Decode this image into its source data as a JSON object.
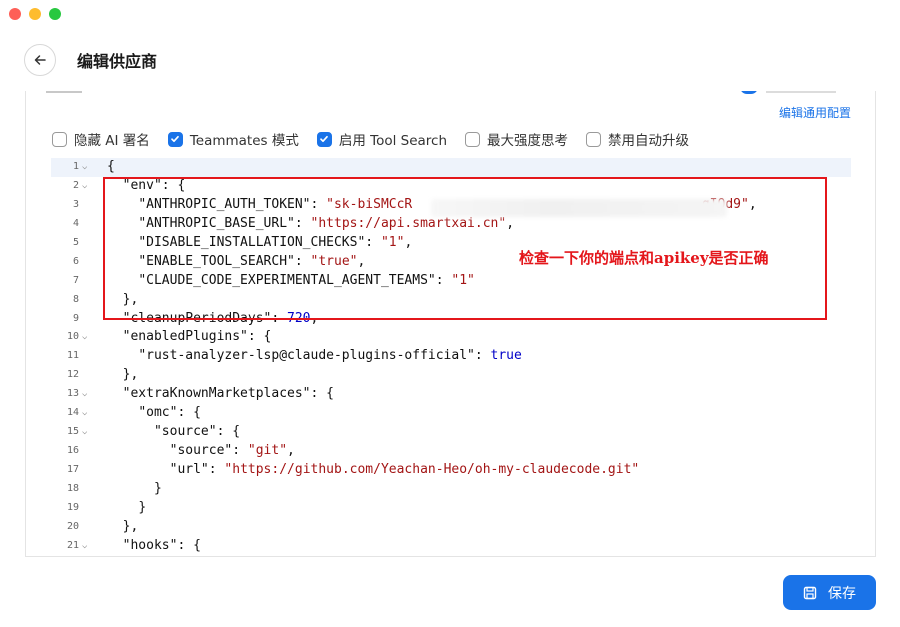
{
  "window": {
    "controls": [
      "close",
      "minimize",
      "maximize"
    ]
  },
  "header": {
    "title": "编辑供应商",
    "back_icon": "arrow-left-icon"
  },
  "panel": {
    "edit_common_label": "编辑通用配置"
  },
  "options": [
    {
      "label": "隐藏 AI 署名",
      "checked": false
    },
    {
      "label": "Teammates 模式",
      "checked": true
    },
    {
      "label": "启用 Tool Search",
      "checked": true
    },
    {
      "label": "最大强度思考",
      "checked": false
    },
    {
      "label": "禁用自动升级",
      "checked": false
    }
  ],
  "editor": {
    "lines": [
      {
        "n": "1",
        "fold": true,
        "indent": 0,
        "parts": [
          [
            "p",
            "{"
          ]
        ]
      },
      {
        "n": "2",
        "fold": true,
        "indent": 1,
        "parts": [
          [
            "k",
            "\"env\""
          ],
          [
            "p",
            ": {"
          ]
        ]
      },
      {
        "n": "3",
        "fold": false,
        "indent": 2,
        "parts": [
          [
            "k",
            "\"ANTHROPIC_AUTH_TOKEN\""
          ],
          [
            "p",
            ": "
          ],
          [
            "s",
            "\"sk-biSMCcR"
          ],
          [
            "p",
            "                                     "
          ],
          [
            "s",
            "gIOd9\""
          ],
          [
            "p",
            ","
          ]
        ]
      },
      {
        "n": "4",
        "fold": false,
        "indent": 2,
        "parts": [
          [
            "k",
            "\"ANTHROPIC_BASE_URL\""
          ],
          [
            "p",
            ": "
          ],
          [
            "s",
            "\"https://api.smartxai.cn\""
          ],
          [
            "p",
            ","
          ]
        ]
      },
      {
        "n": "5",
        "fold": false,
        "indent": 2,
        "parts": [
          [
            "k",
            "\"DISABLE_INSTALLATION_CHECKS\""
          ],
          [
            "p",
            ": "
          ],
          [
            "s",
            "\"1\""
          ],
          [
            "p",
            ","
          ]
        ]
      },
      {
        "n": "6",
        "fold": false,
        "indent": 2,
        "parts": [
          [
            "k",
            "\"ENABLE_TOOL_SEARCH\""
          ],
          [
            "p",
            ": "
          ],
          [
            "s",
            "\"true\""
          ],
          [
            "p",
            ","
          ]
        ]
      },
      {
        "n": "7",
        "fold": false,
        "indent": 2,
        "parts": [
          [
            "k",
            "\"CLAUDE_CODE_EXPERIMENTAL_AGENT_TEAMS\""
          ],
          [
            "p",
            ": "
          ],
          [
            "s",
            "\"1\""
          ]
        ]
      },
      {
        "n": "8",
        "fold": false,
        "indent": 1,
        "parts": [
          [
            "p",
            "},"
          ]
        ]
      },
      {
        "n": "9",
        "fold": false,
        "indent": 1,
        "parts": [
          [
            "k",
            "\"cleanupPeriodDays\""
          ],
          [
            "p",
            ": "
          ],
          [
            "b",
            "720"
          ],
          [
            "p",
            ","
          ]
        ]
      },
      {
        "n": "10",
        "fold": true,
        "indent": 1,
        "parts": [
          [
            "k",
            "\"enabledPlugins\""
          ],
          [
            "p",
            ": {"
          ]
        ]
      },
      {
        "n": "11",
        "fold": false,
        "indent": 2,
        "parts": [
          [
            "k",
            "\"rust-analyzer-lsp@claude-plugins-official\""
          ],
          [
            "p",
            ": "
          ],
          [
            "b",
            "true"
          ]
        ]
      },
      {
        "n": "12",
        "fold": false,
        "indent": 1,
        "parts": [
          [
            "p",
            "},"
          ]
        ]
      },
      {
        "n": "13",
        "fold": true,
        "indent": 1,
        "parts": [
          [
            "k",
            "\"extraKnownMarketplaces\""
          ],
          [
            "p",
            ": {"
          ]
        ]
      },
      {
        "n": "14",
        "fold": true,
        "indent": 2,
        "parts": [
          [
            "k",
            "\"omc\""
          ],
          [
            "p",
            ": {"
          ]
        ]
      },
      {
        "n": "15",
        "fold": true,
        "indent": 3,
        "parts": [
          [
            "k",
            "\"source\""
          ],
          [
            "p",
            ": {"
          ]
        ]
      },
      {
        "n": "16",
        "fold": false,
        "indent": 4,
        "parts": [
          [
            "k",
            "\"source\""
          ],
          [
            "p",
            ": "
          ],
          [
            "s",
            "\"git\""
          ],
          [
            "p",
            ","
          ]
        ]
      },
      {
        "n": "17",
        "fold": false,
        "indent": 4,
        "parts": [
          [
            "k",
            "\"url\""
          ],
          [
            "p",
            ": "
          ],
          [
            "s",
            "\"https://github.com/Yeachan-Heo/oh-my-claudecode.git\""
          ]
        ]
      },
      {
        "n": "18",
        "fold": false,
        "indent": 3,
        "parts": [
          [
            "p",
            "}"
          ]
        ]
      },
      {
        "n": "19",
        "fold": false,
        "indent": 2,
        "parts": [
          [
            "p",
            "}"
          ]
        ]
      },
      {
        "n": "20",
        "fold": false,
        "indent": 1,
        "parts": [
          [
            "p",
            "},"
          ]
        ]
      },
      {
        "n": "21",
        "fold": true,
        "indent": 1,
        "parts": [
          [
            "k",
            "\"hooks\""
          ],
          [
            "p",
            ": {"
          ]
        ]
      }
    ]
  },
  "annotation": {
    "text": "检查一下你的端点和apikey是否正确",
    "color": "#e4161b"
  },
  "footer": {
    "save_label": "保存",
    "save_icon": "save-icon"
  },
  "colors": {
    "accent": "#1a73e8",
    "annotation_red": "#e4161b",
    "string": "#a31515",
    "keyword": "#0000c8"
  }
}
